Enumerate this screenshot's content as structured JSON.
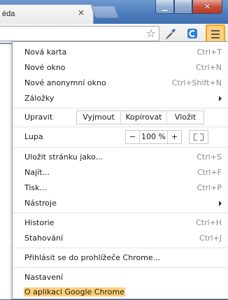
{
  "tab": {
    "title": "éda",
    "close_label": "×"
  },
  "window": {
    "minimize": "▁",
    "maximize": "▢",
    "close": "✕"
  },
  "menu": {
    "items_top": [
      {
        "label": "Nová karta",
        "shortcut": "Ctrl+T"
      },
      {
        "label": "Nové okno",
        "shortcut": "Ctrl+N"
      },
      {
        "label": "Nové anonymní okno",
        "shortcut": "Ctrl+Shift+N"
      },
      {
        "label": "Záložky",
        "shortcut": ""
      }
    ],
    "edit": {
      "label": "Upravit",
      "cut": "Vyjmout",
      "copy": "Kopírovat",
      "paste": "Vložit"
    },
    "zoom": {
      "label": "Lupa",
      "minus": "−",
      "value": "100 %",
      "plus": "+"
    },
    "items_mid": [
      {
        "label": "Uložit stránku jako...",
        "shortcut": "Ctrl+S"
      },
      {
        "label": "Najít...",
        "shortcut": "Ctrl+F"
      },
      {
        "label": "Tisk...",
        "shortcut": "Ctrl+P"
      },
      {
        "label": "Nástroje",
        "shortcut": ""
      }
    ],
    "items_hist": [
      {
        "label": "Historie",
        "shortcut": "Ctrl+H"
      },
      {
        "label": "Stahování",
        "shortcut": "Ctrl+J"
      }
    ],
    "signin": "Přihlásit se do prohlížeče Chrome...",
    "settings": "Nastavení",
    "about": "O aplikaci Google Chrome"
  },
  "colors": {
    "highlight": "#ffd079",
    "menu_button_border": "#f2a31c"
  }
}
